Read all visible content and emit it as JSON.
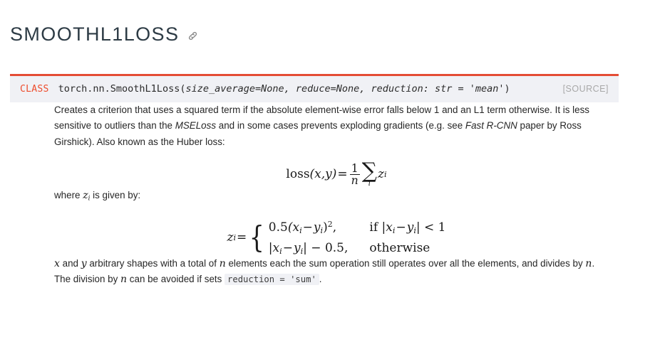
{
  "heading": {
    "title": "SMOOTHL1LOSS",
    "anchor_icon": "link-chain-icon"
  },
  "signature": {
    "class_label": "CLASS",
    "qualified_name": "torch.nn.SmoothL1Loss",
    "open_paren": "(",
    "params": "size_average=None, reduce=None, reduction: str = 'mean'",
    "close_paren": ")",
    "full_signature": "torch.nn.SmoothL1Loss(size_average=None, reduce=None, reduction: str = 'mean')",
    "source_label": "[SOURCE]",
    "accent_color": "#ee4c2c",
    "box_background": "#f0f1f5"
  },
  "body": {
    "description": {
      "seg1": "Creates a criterion that uses a squared term if the absolute element-wise error falls below 1 and an L1 term otherwise. It is less sensitive to outliers than the ",
      "link1": "MSELoss",
      "seg2": " and in some cases prevents exploding gradients (e.g. see ",
      "link2": "Fast R-CNN",
      "seg3": " paper by Ross Girshick). Also known as the Huber loss:"
    },
    "where_line": {
      "prefix": "where ",
      "symbol": "z",
      "symbol_sub": "i",
      "suffix": " is given by:"
    },
    "shapes_paragraph": {
      "x": "x",
      "and": " and ",
      "y": "y",
      "mid": " arbitrary shapes with a total of ",
      "n": "n",
      "tail": " elements each the sum operation still operates over all the elements, and divides by ",
      "n2": "n",
      "period": "."
    },
    "division_paragraph": {
      "prefix": "The division by ",
      "n": "n",
      "mid": " can be avoided if sets ",
      "code": "reduction = 'sum'",
      "period": "."
    }
  },
  "formulas": {
    "loss": {
      "lhs_func": "loss",
      "lhs_args": "(x,y)",
      "equals": "=",
      "frac_num": "1",
      "frac_den": "n",
      "bigop": "∑",
      "bigop_index": "i",
      "term": "z",
      "term_sub": "i"
    },
    "piecewise": {
      "lhs": "z",
      "lhs_sub": "i",
      "equals": "=",
      "case1_expr_coef": "0.5",
      "case1_expr_body": "(x",
      "case1_sub1": "i",
      "case1_minus": "−",
      "case1_y": "y",
      "case1_sub2": "i",
      "case1_close": ")",
      "case1_power": "2",
      "case1_comma": ",",
      "case1_cond_if": "if ",
      "case1_cond_expr": "|x",
      "case1_cond_sub1": "i",
      "case1_cond_minus": "−",
      "case1_cond_y": "y",
      "case1_cond_sub2": "i",
      "case1_cond_barlt": "| < 1",
      "case2_expr": "|x",
      "case2_sub1": "i",
      "case2_minus": "−",
      "case2_y": "y",
      "case2_sub2": "i",
      "case2_tail": "| − 0.5,",
      "case2_cond": "otherwise"
    }
  }
}
